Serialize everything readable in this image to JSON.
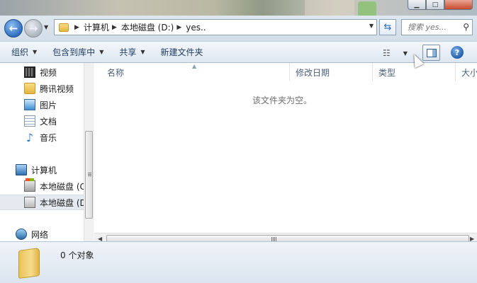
{
  "window": {
    "minimize_label": "▁",
    "maximize_label": "□",
    "close_label": ""
  },
  "address": {
    "crumbs": [
      "计算机",
      "本地磁盘 (D:)",
      "yes.."
    ],
    "search_placeholder": "搜索 yes..."
  },
  "toolbar": {
    "organize": "组织",
    "include_in_library": "包含到库中",
    "share": "共享",
    "new_folder": "新建文件夹"
  },
  "sidebar": {
    "items": [
      {
        "label": "视频",
        "icon": "video-icon"
      },
      {
        "label": "腾讯视频",
        "icon": "folder-icon"
      },
      {
        "label": "图片",
        "icon": "pictures-icon"
      },
      {
        "label": "文档",
        "icon": "documents-icon"
      },
      {
        "label": "音乐",
        "icon": "music-icon"
      },
      {
        "label": "计算机",
        "icon": "computer-icon"
      },
      {
        "label": "本地磁盘 (C",
        "icon": "drive-c-icon"
      },
      {
        "label": "本地磁盘 (D",
        "icon": "drive-d-icon"
      },
      {
        "label": "网络",
        "icon": "network-icon"
      }
    ]
  },
  "columns": {
    "name": "名称",
    "modified": "修改日期",
    "type": "类型",
    "size": "大小"
  },
  "content": {
    "empty_message": "该文件夹为空。"
  },
  "details": {
    "object_count": "0 个对象"
  }
}
